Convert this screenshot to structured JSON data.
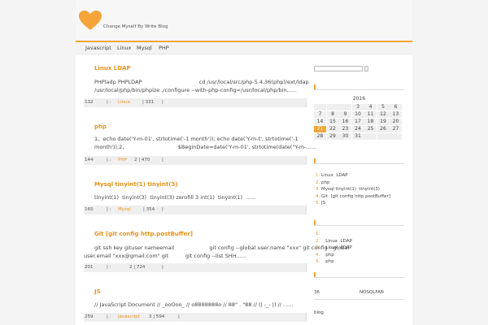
{
  "header": {
    "tagline": "Change Myself By Write Blog"
  },
  "nav": {
    "items": [
      "Javascript",
      "Linux",
      "Mysql",
      "PHP"
    ]
  },
  "posts": [
    {
      "title": "Linux  LDAP",
      "body1": "PHPladp PHPLDAP                                  cd /usr/local/src/php-5.4.36(php)/ext/ldap",
      "body2": "/usr/local/php/bin/phpize ./configure --with-php-config=/usr/local/php/bin......",
      "meta_num": "132",
      "meta_sep": "|  :",
      "meta_cat": "Linux",
      "meta_count": "| 331",
      "meta_end": "|"
    },
    {
      "title": "php",
      "body1": "1、echo date('Y-m-01', strtotime('-1 month')); echo date('Y-m-t', strtotime('-1",
      "body2": "month'));2、                              $BeginDate=date('Y-m-01', strtotime(date(\"Y-m-......",
      "meta_num": "144",
      "meta_sep": "|  :",
      "meta_cat": "PHP",
      "meta_count": "2  | 470",
      "meta_end": "|"
    },
    {
      "title": "Mysql tinyint(1)  tinyint(3)",
      "body1": "tinyint(1)  tinyint(3)  tinyint(3) zerofill 3 int(1)  tinyint(1)  ......",
      "body2": "",
      "meta_num": "165",
      "meta_sep": "|  :",
      "meta_cat": "Mysql",
      "meta_count": "| 354",
      "meta_end": "|"
    },
    {
      "title": "Git  [git config http.postBuffer]",
      "body1": "git ssh key gituser nameemail                     git config --global user.name \"xxx\" git config --global",
      "body2": "user.email \"xxx@gmail.com\" git          git config --list SHH......",
      "meta_num": "201",
      "meta_sep": "|  :",
      "meta_cat": "",
      "meta_count": "2 | 724",
      "meta_end": "|"
    },
    {
      "title": "JS",
      "body1": "// JavaScript Document // _ooOoo_ // o8888888o // 88\" . \"88 // (| -_- |) // ......",
      "body2": "",
      "meta_num": "259",
      "meta_sep": "|  :",
      "meta_cat": "Javascript",
      "meta_count": "3 | 594",
      "meta_end": "|"
    }
  ],
  "calendar": {
    "year": "2016",
    "rows": [
      [
        "",
        "",
        "",
        "",
        "",
        "",
        ""
      ],
      [
        "",
        "",
        "",
        "",
        "",
        "",
        ""
      ],
      [
        "7",
        "8",
        "9",
        "10",
        "11",
        "12",
        "13"
      ],
      [
        "14",
        "15",
        "16",
        "17",
        "18",
        "19",
        "20"
      ],
      [
        "21",
        "22",
        "23",
        "24",
        "25",
        "26",
        "27"
      ],
      [
        "28",
        "29",
        "30",
        "31",
        "",
        "",
        ""
      ]
    ],
    "top_rows": [
      [
        "",
        "",
        "",
        "",
        "3",
        "4",
        "5",
        "6"
      ]
    ],
    "today": "21"
  },
  "recent": [
    {
      "num": "1.",
      "text": "Linux  LDAP"
    },
    {
      "num": "2.",
      "text": "php"
    },
    {
      "num": "3.",
      "text": "Mysql tinyint(1)  tinyint(3)"
    },
    {
      "num": "4.",
      "text": "Git  [git config http.postBuffer]"
    },
    {
      "num": "5.",
      "text": "JS"
    }
  ],
  "hot": [
    {
      "num": "1.",
      "text": ""
    },
    {
      "num": "2.",
      "text": "    Linux  LDAP"
    },
    {
      "num": "3.",
      "text": "    Linux  LDAP"
    },
    {
      "num": "4.",
      "text": "    php"
    },
    {
      "num": "5.",
      "text": "    php"
    }
  ],
  "stats": {
    "count": "36",
    "name": "NOSQLFAN"
  },
  "blog_label": "blog",
  "colors": {
    "accent": "#f2a531",
    "title": "#e8931a"
  }
}
